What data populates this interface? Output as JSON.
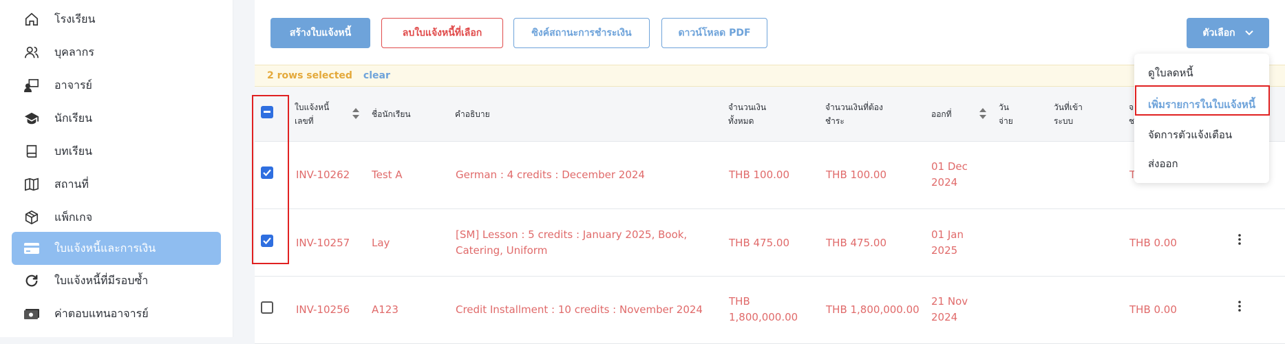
{
  "sidebar": {
    "items": [
      {
        "label": "โรงเรียน",
        "icon": "home-icon"
      },
      {
        "label": "บุคลากร",
        "icon": "users-icon"
      },
      {
        "label": "อาจารย์",
        "icon": "teacher-icon"
      },
      {
        "label": "นักเรียน",
        "icon": "graduation-cap-icon"
      },
      {
        "label": "บทเรียน",
        "icon": "book-icon"
      },
      {
        "label": "สถานที่",
        "icon": "map-icon"
      },
      {
        "label": "แพ็กเกจ",
        "icon": "package-icon"
      },
      {
        "label": "ใบแจ้งหนี้และการเงิน",
        "icon": "credit-card-icon",
        "active": true
      },
      {
        "label": "ใบแจ้งหนี้ที่มีรอบซ้ำ",
        "icon": "refresh-icon"
      },
      {
        "label": "ค่าตอบแทนอาจารย์",
        "icon": "money-icon"
      }
    ]
  },
  "toolbar": {
    "create_label": "สร้างใบแจ้งหนี้",
    "delete_label": "ลบใบแจ้งหนี้ที่เลือก",
    "sync_label": "ซิงค์สถานะการชำระเงิน",
    "pdf_label": "ดาวน์โหลด PDF",
    "options_label": "ตัวเลือก"
  },
  "selection": {
    "count_text": "2 rows selected",
    "clear_text": "clear"
  },
  "table": {
    "headers": {
      "invoice_no": [
        "ใบแจ้งหนี้",
        "เลขที่"
      ],
      "student": "ชื่อนักเรียน",
      "description": "คำอธิบาย",
      "total": [
        "จำนวนเงิน",
        "ทั้งหมด"
      ],
      "due": [
        "จำนวนเงินที่ต้อง",
        "ชำระ"
      ],
      "issued": "ออกที่",
      "paid_date": [
        "วัน",
        "จ่าย"
      ],
      "entered": [
        "วันที่เข้า",
        "ระบบ"
      ],
      "partial": [
        "จ",
        "ช"
      ]
    },
    "rows": [
      {
        "checked": true,
        "invoice": "INV-10262",
        "student": "Test A",
        "description": [
          "German : 4 credits : December 2024"
        ],
        "total": [
          "THB 100.00"
        ],
        "due": "THB 100.00",
        "issued": [
          "01 Dec",
          "2024"
        ],
        "remaining": "T"
      },
      {
        "checked": true,
        "invoice": "INV-10257",
        "student": "Lay",
        "description": [
          "[SM] Lesson : 5 credits : January 2025, Book,",
          "Catering, Uniform"
        ],
        "total": [
          "THB 475.00"
        ],
        "due": "THB 475.00",
        "issued": [
          "01 Jan",
          "2025"
        ],
        "remaining": "THB 0.00"
      },
      {
        "checked": false,
        "invoice": "INV-10256",
        "student": "A123",
        "description": [
          "Credit Installment : 10 credits : November 2024"
        ],
        "total": [
          "THB",
          "1,800,000.00"
        ],
        "due": "THB 1,800,000.00",
        "issued": [
          "21 Nov",
          "2024"
        ],
        "remaining": "THB 0.00"
      }
    ]
  },
  "dropdown": {
    "items": [
      "ดูใบลดหนี้",
      "เพิ่มรายการในใบแจ้งหนี้",
      "จัดการตัวแจ้งเตือน",
      "ส่งออก"
    ]
  }
}
